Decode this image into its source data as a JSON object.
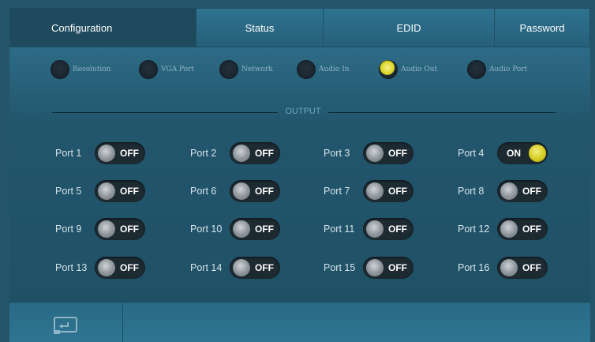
{
  "tabs": [
    "Configuration",
    "Status",
    "EDID",
    "Password"
  ],
  "subnav": [
    {
      "label": "Resolution",
      "active": false
    },
    {
      "label": "VGA Port",
      "active": false
    },
    {
      "label": "Network",
      "active": false
    },
    {
      "label": "Audio In",
      "active": false
    },
    {
      "label": "Audio Out",
      "active": true
    },
    {
      "label": "Audio Port",
      "active": false
    }
  ],
  "section_title": "OUTPUT",
  "ports": [
    {
      "label": "Port 1",
      "state": "OFF"
    },
    {
      "label": "Port 2",
      "state": "OFF"
    },
    {
      "label": "Port 3",
      "state": "OFF"
    },
    {
      "label": "Port 4",
      "state": "ON"
    },
    {
      "label": "Port 5",
      "state": "OFF"
    },
    {
      "label": "Port 6",
      "state": "OFF"
    },
    {
      "label": "Port 7",
      "state": "OFF"
    },
    {
      "label": "Port 8",
      "state": "OFF"
    },
    {
      "label": "Port 9",
      "state": "OFF"
    },
    {
      "label": "Port 10",
      "state": "OFF"
    },
    {
      "label": "Port 11",
      "state": "OFF"
    },
    {
      "label": "Port 12",
      "state": "OFF"
    },
    {
      "label": "Port 13",
      "state": "OFF"
    },
    {
      "label": "Port 14",
      "state": "OFF"
    },
    {
      "label": "Port 15",
      "state": "OFF"
    },
    {
      "label": "Port 16",
      "state": "OFF"
    }
  ],
  "footer": {
    "back_icon": "return-icon"
  },
  "colors": {
    "accent_on": "#d7d21c",
    "background": "#25556a"
  }
}
